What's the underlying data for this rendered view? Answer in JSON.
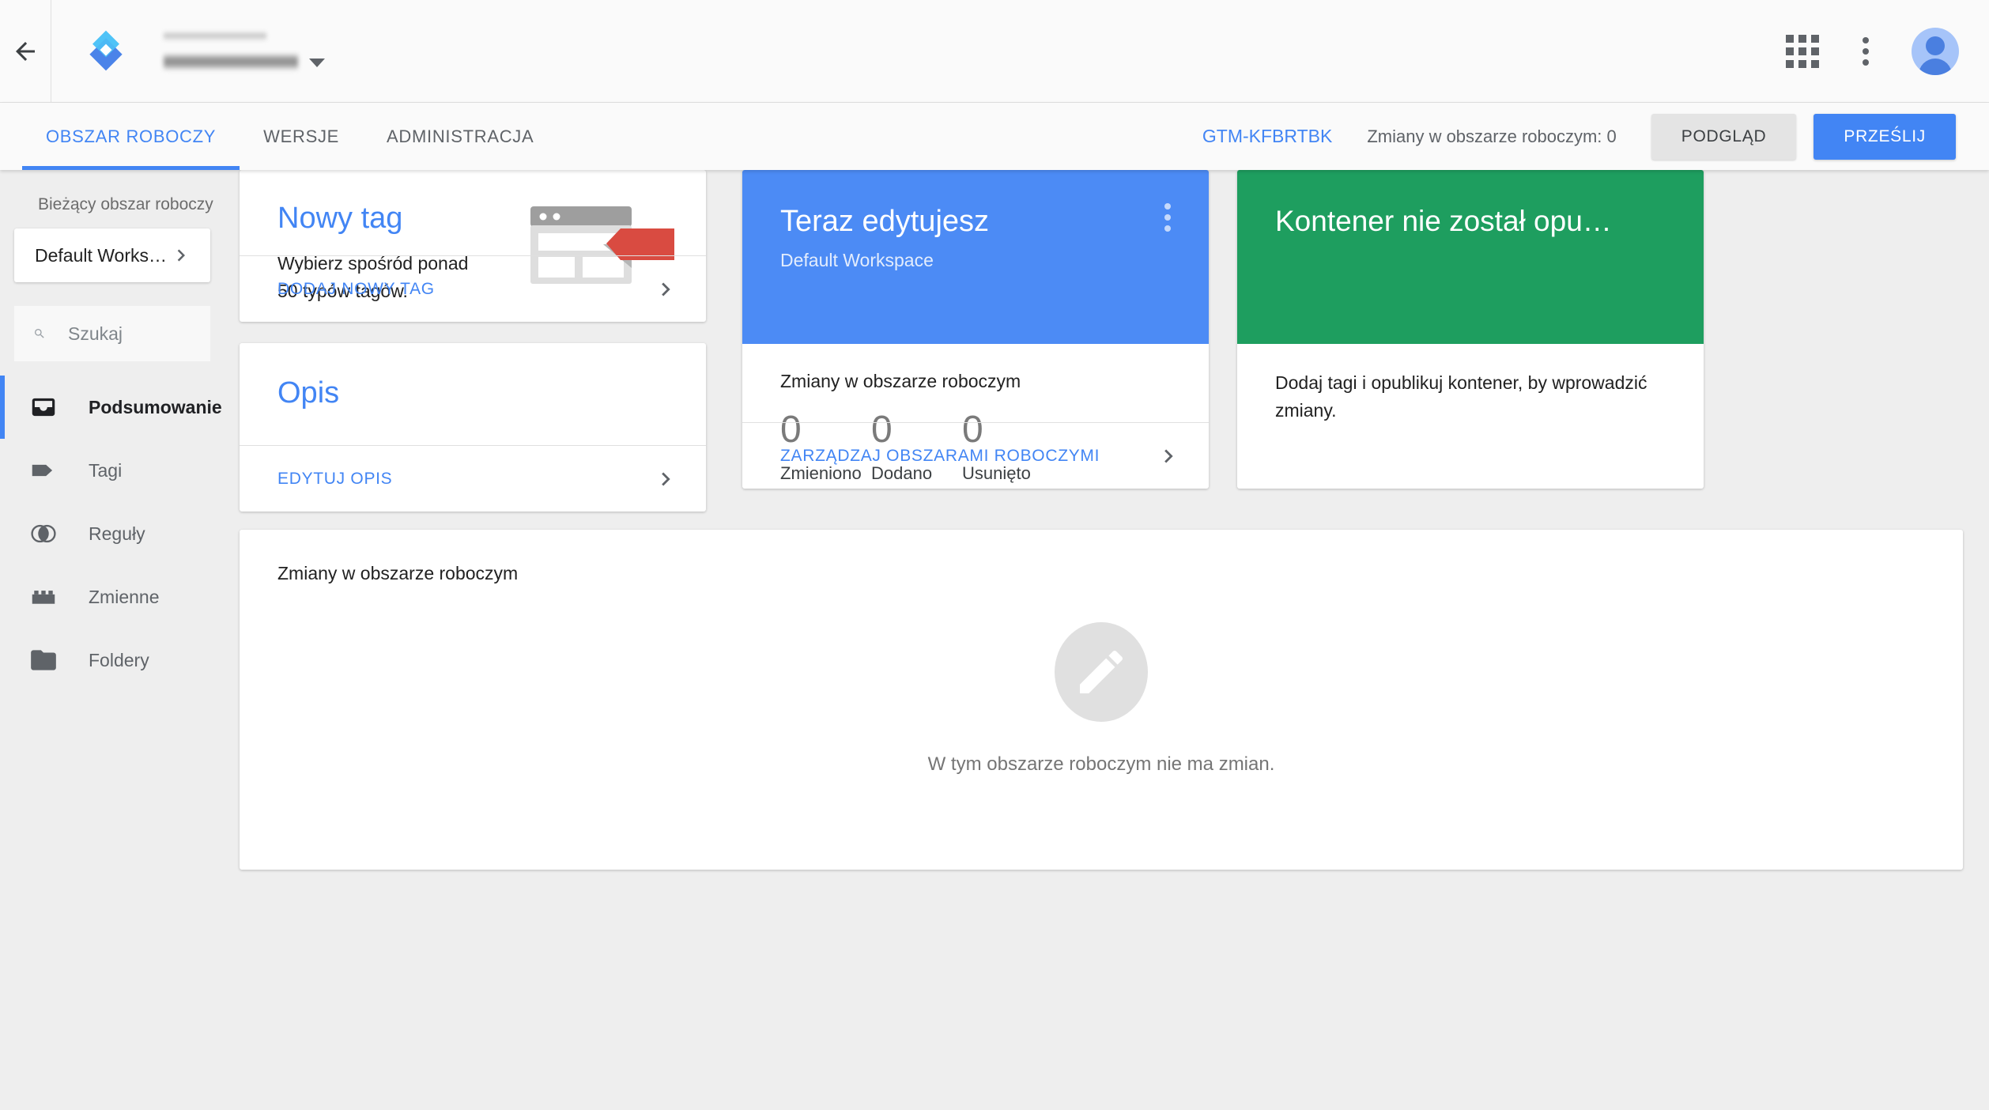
{
  "header": {
    "back_icon": "arrow-back-icon",
    "logo_icon": "gtm-logo-icon",
    "account_name_redacted": "",
    "container_name_redacted": "",
    "caret_icon": "chevron-down-icon",
    "apps_icon": "apps-grid-icon",
    "more_icon": "more-vert-icon",
    "avatar_icon": "user-avatar-icon"
  },
  "tabs": [
    {
      "label": "OBSZAR ROBOCZY",
      "active": true
    },
    {
      "label": "WERSJE",
      "active": false
    },
    {
      "label": "ADMINISTRACJA",
      "active": false
    }
  ],
  "tabbar_right": {
    "container_id": "GTM-KFBRTBK",
    "workspace_changes": "Zmiany w obszarze roboczym: 0",
    "preview_label": "PODGLĄD",
    "submit_label": "PRZEŚLIJ"
  },
  "sidebar": {
    "current_workspace_label": "Bieżący obszar roboczy",
    "workspace_name": "Default Workspace",
    "workspace_chevron_icon": "chevron-right-icon",
    "search_placeholder": "Szukaj",
    "search_value": "",
    "search_icon": "search-icon",
    "items": [
      {
        "label": "Podsumowanie",
        "icon": "inbox-icon",
        "active": true
      },
      {
        "label": "Tagi",
        "icon": "tag-icon",
        "active": false
      },
      {
        "label": "Reguły",
        "icon": "trigger-circles-icon",
        "active": false
      },
      {
        "label": "Zmienne",
        "icon": "variable-brick-icon",
        "active": false
      },
      {
        "label": "Foldery",
        "icon": "folder-icon",
        "active": false
      }
    ]
  },
  "cards": {
    "new_tag": {
      "title": "Nowy tag",
      "description": "Wybierz spośród ponad 50 typów tagów.",
      "action_label": "DODAJ NOWY TAG",
      "action_chevron_icon": "chevron-right-icon",
      "illustration_icon": "browser-with-tag-illustration"
    },
    "description": {
      "title": "Opis",
      "action_label": "EDYTUJ OPIS",
      "action_chevron_icon": "chevron-right-icon"
    },
    "workspace": {
      "title": "Teraz edytujesz",
      "subtitle": "Default Workspace",
      "menu_icon": "more-vert-icon",
      "stats_title": "Zmiany w obszarze roboczym",
      "stats": [
        {
          "value": "0",
          "label": "Zmieniono"
        },
        {
          "value": "0",
          "label": "Dodano"
        },
        {
          "value": "0",
          "label": "Usunięto"
        }
      ],
      "action_label": "ZARZĄDZAJ OBSZARAMI ROBOCZYMI",
      "action_chevron_icon": "chevron-right-icon",
      "accent_color": "#4C8BF5"
    },
    "container": {
      "title": "Kontener nie został opu…",
      "body": "Dodaj tagi i opublikuj kontener, by wprowadzić zmiany.",
      "accent_color": "#1E9E5F"
    },
    "changes": {
      "title": "Zmiany w obszarze roboczym",
      "empty_icon": "edit-pencil-icon",
      "empty_message": "W tym obszarze roboczym nie ma zmian."
    }
  },
  "colors": {
    "brand_blue": "#4285F4",
    "green": "#1E9E5F",
    "tag_red": "#D94B41",
    "page_bg": "#EEEEEE"
  }
}
